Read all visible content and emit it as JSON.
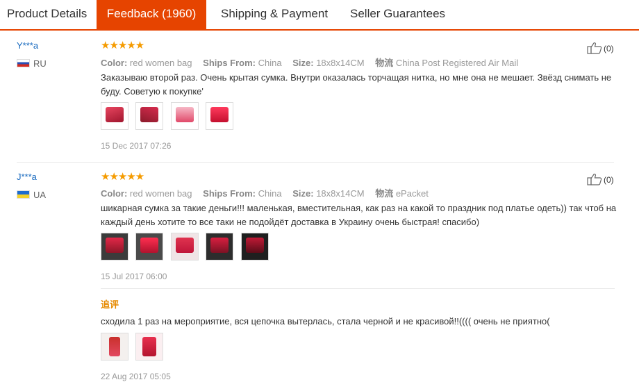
{
  "tabs": [
    {
      "label": "Product Details"
    },
    {
      "label": "Feedback (1960)"
    },
    {
      "label": "Shipping & Payment"
    },
    {
      "label": "Seller Guarantees"
    }
  ],
  "meta_labels": {
    "color": "Color:",
    "ships_from": "Ships From:",
    "size": "Size:",
    "logistics": "物流"
  },
  "reviews": [
    {
      "user": "Y***a",
      "country": "RU",
      "stars": "★★★★★",
      "color": "red women bag",
      "ships_from": "China",
      "size": "18x8x14CM",
      "logistics": "China Post Registered Air Mail",
      "text": "Заказываю второй раз. Очень крытая сумка. Внутри оказалась торчащая нитка, но мне она не мешает. Звёзд снимать не буду. Советую к покупке'",
      "date": "15 Dec 2017 07:26",
      "likes": "(0)"
    },
    {
      "user": "J***a",
      "country": "UA",
      "stars": "★★★★★",
      "color": "red women bag",
      "ships_from": "China",
      "size": "18x8x14CM",
      "logistics": "ePacket",
      "text": "шикарная сумка за такие деньги!!! маленькая, вместительная, как раз на какой то праздник под платье одеть)) так чтоб на каждый день хотите то все таки не подойдёт доставка в Украину очень быстрая! спасибо)",
      "date": "15 Jul 2017 06:00",
      "likes": "(0)",
      "additional": {
        "title": "追评",
        "text": "сходила 1 раз на мероприятие, вся цепочка вытерлась, стала черной и не красивой!!(((( очень не приятно(",
        "date": "22 Aug 2017 05:05"
      }
    }
  ],
  "colors": {
    "accent": "#e64400",
    "user_link": "#1a6bbf",
    "stars": "#f59b00",
    "additional_title": "#e68a00"
  }
}
